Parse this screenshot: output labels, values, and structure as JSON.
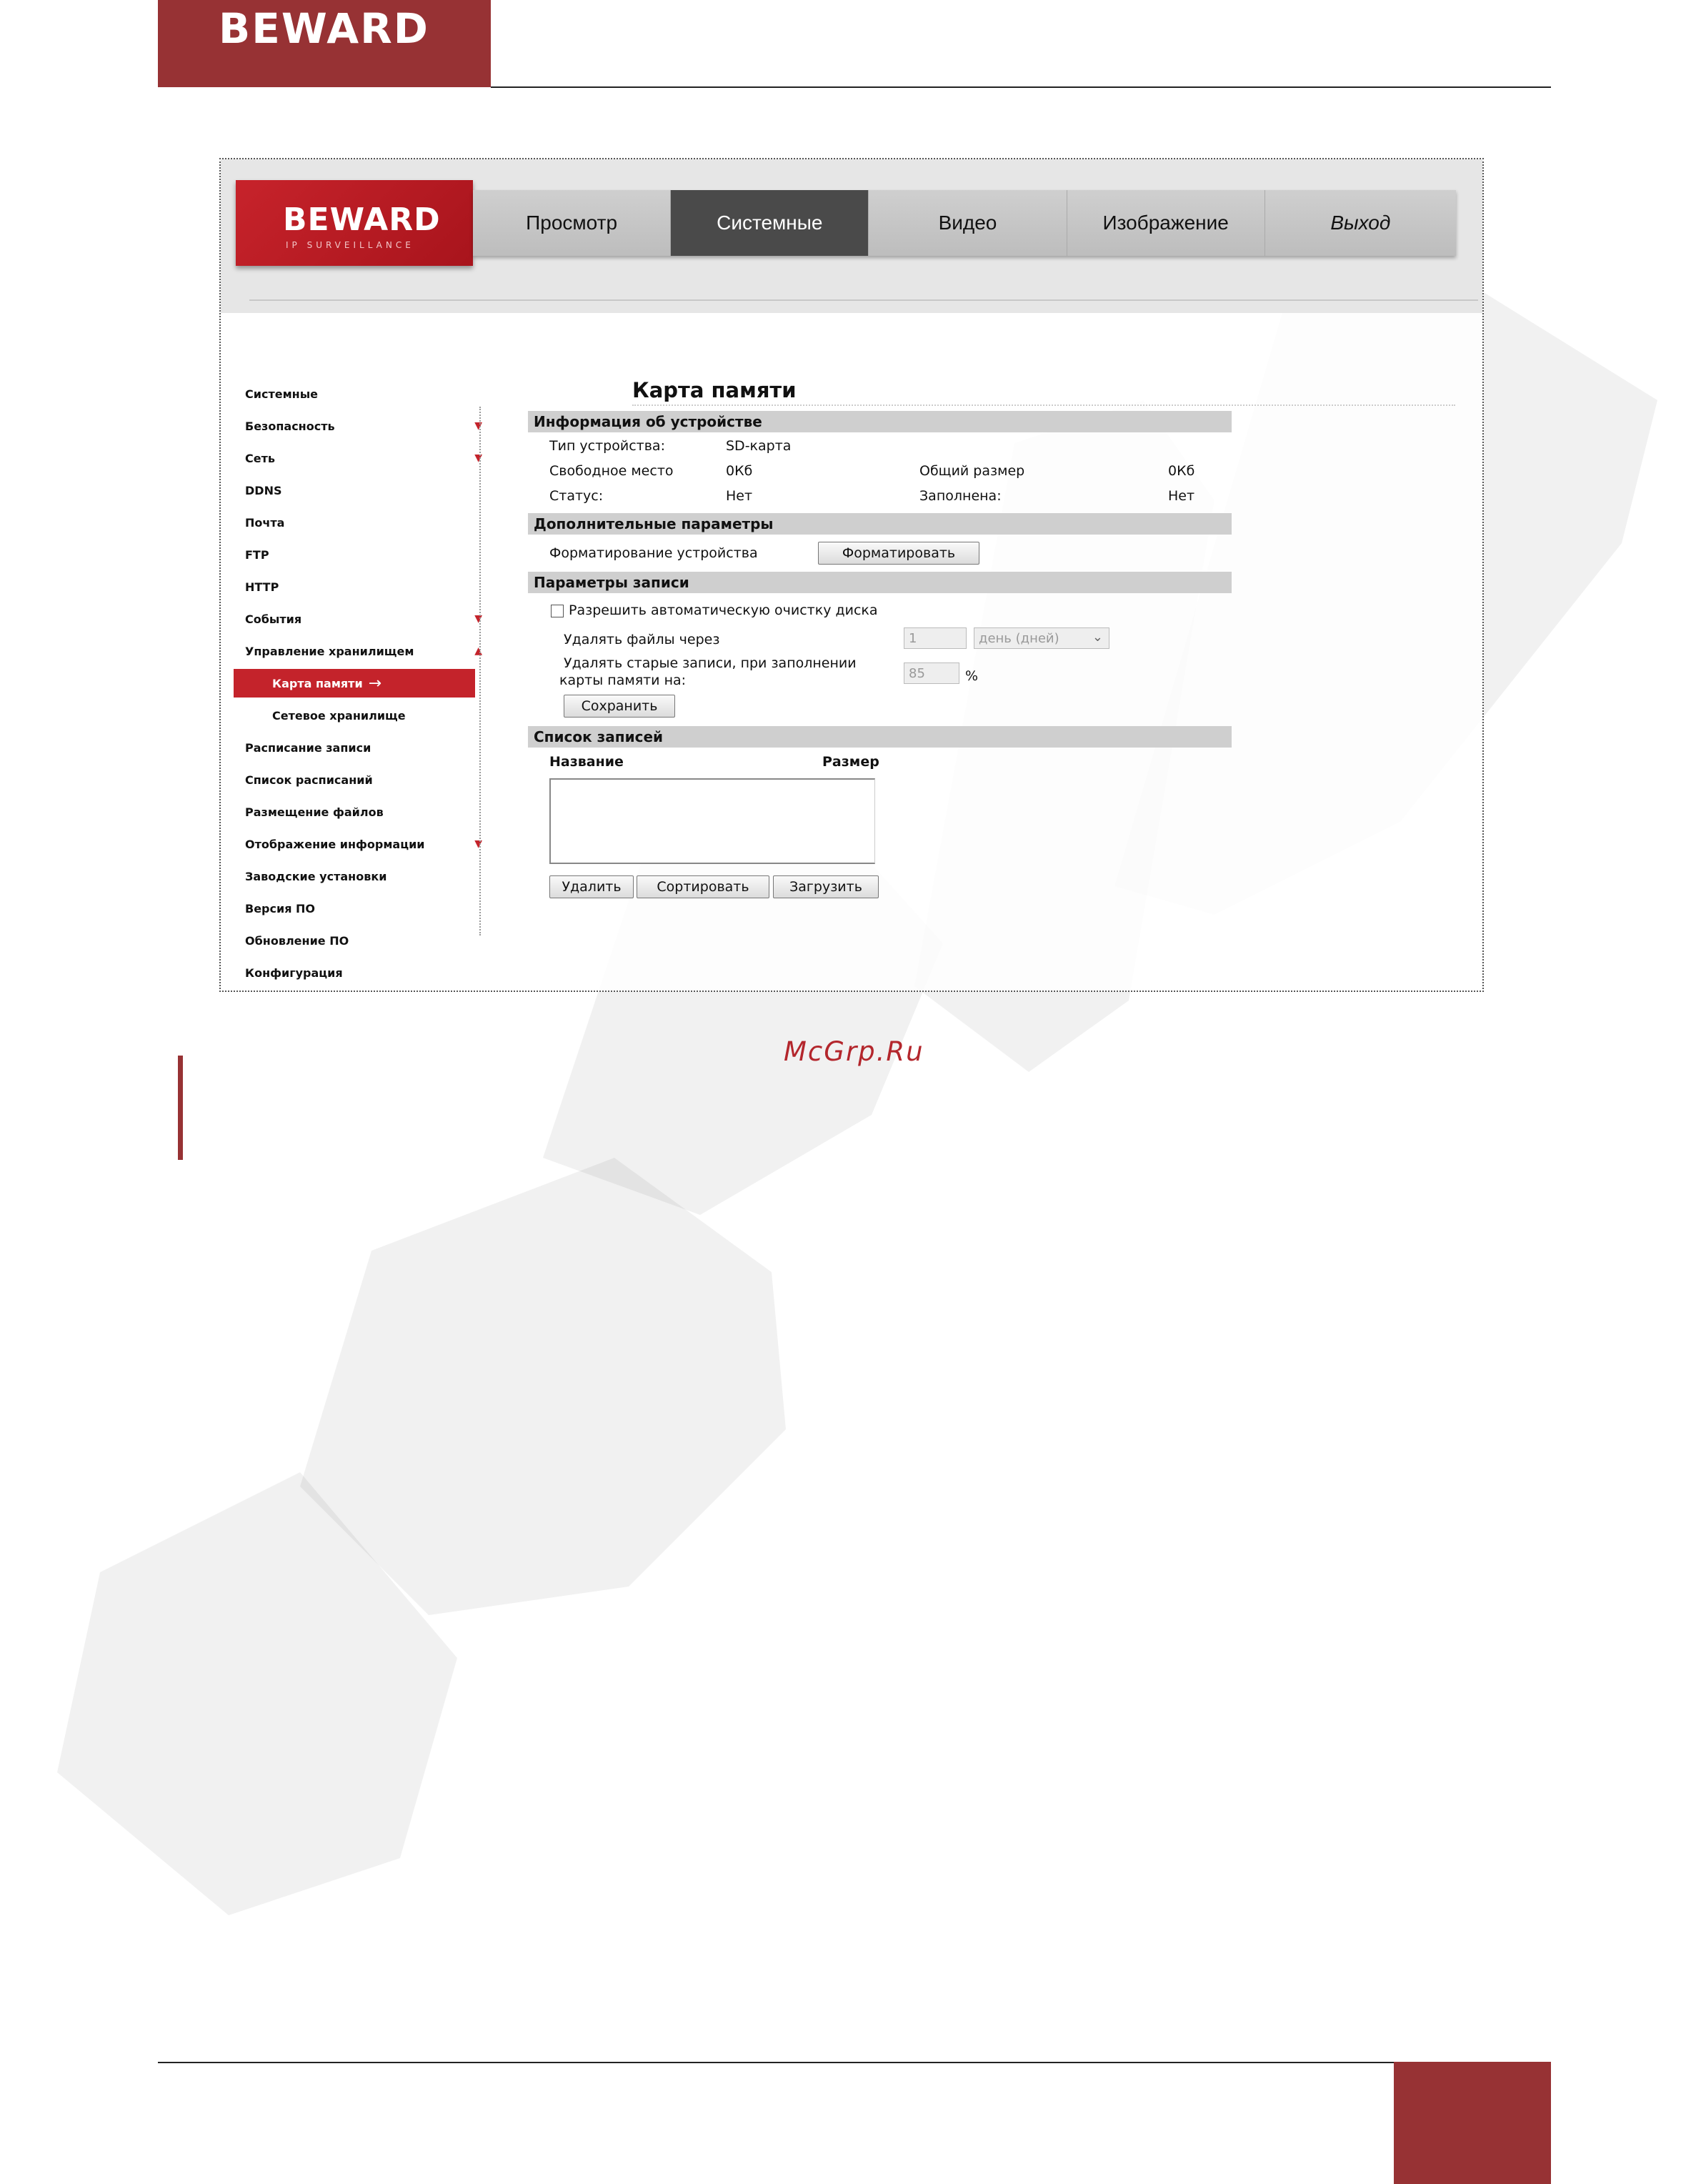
{
  "document": {
    "logo_text": "BEWARD",
    "watermark_link": "McGrp.Ru",
    "colors": {
      "brand": "#973234",
      "accent_red": "#c4232b",
      "section_gray": "#cfcfcf",
      "nav_active": "#4a4a4a"
    }
  },
  "camera_ui": {
    "logo": {
      "text": "BEWARD",
      "subtitle": "IP SURVEILLANCE"
    },
    "nav_tabs": [
      {
        "label": "Просмотр",
        "active": false
      },
      {
        "label": "Системные",
        "active": true
      },
      {
        "label": "Видео",
        "active": false
      },
      {
        "label": "Изображение",
        "active": false
      },
      {
        "label": "Выход",
        "active": false
      }
    ],
    "sidebar": {
      "items": [
        {
          "label": "Системные"
        },
        {
          "label": "Безопасность",
          "expand_icon": "arrow-down"
        },
        {
          "label": "Сеть",
          "expand_icon": "arrow-down"
        },
        {
          "label": "DDNS"
        },
        {
          "label": "Почта"
        },
        {
          "label": "FTP"
        },
        {
          "label": "HTTP"
        },
        {
          "label": "События",
          "expand_icon": "arrow-down"
        },
        {
          "label": "Управление хранилищем",
          "expand_icon": "arrow-up"
        },
        {
          "label": "Карта памяти",
          "sub": true,
          "active": true
        },
        {
          "label": "Сетевое хранилище",
          "sub": true
        },
        {
          "label": "Расписание записи"
        },
        {
          "label": "Список расписаний"
        },
        {
          "label": "Размещение файлов"
        },
        {
          "label": "Отображение информации",
          "expand_icon": "arrow-down"
        },
        {
          "label": "Заводские установки"
        },
        {
          "label": "Версия ПО"
        },
        {
          "label": "Обновление ПО"
        },
        {
          "label": "Конфигурация"
        }
      ],
      "arrow_down_glyph": "▼",
      "arrow_up_glyph": "▲",
      "active_arrow_glyph": "→"
    },
    "page_title": "Карта памяти",
    "device_info": {
      "section_label": "Информация об устройстве",
      "type_label": "Тип устройства:",
      "type_value": "SD-карта",
      "free_label": "Свободное место",
      "free_value": "0Кб",
      "total_label": "Общий размер",
      "total_value": "0Кб",
      "status_label": "Статус:",
      "status_value": "Нет",
      "full_label": "Заполнена:",
      "full_value": "Нет"
    },
    "extra_params": {
      "section_label": "Дополнительные параметры",
      "format_label": "Форматирование устройства",
      "format_button": "Форматировать"
    },
    "record_params": {
      "section_label": "Параметры записи",
      "auto_clean_label": "Разрешить автоматическую очистку диска",
      "auto_clean_checked": false,
      "delete_after_label": "Удалять файлы через",
      "delete_after_value": "1",
      "delete_after_unit": "день (дней)",
      "delete_old_label_line1": "Удалять старые записи, при заполнении",
      "delete_old_label_line2": "карты памяти на:",
      "delete_old_value": "85",
      "percent_sign": "%",
      "save_button": "Сохранить"
    },
    "records_list": {
      "section_label": "Список записей",
      "col_name": "Название",
      "col_size": "Размер",
      "rows": [],
      "delete_button": "Удалить",
      "sort_button": "Сортировать",
      "download_button": "Загрузить"
    }
  }
}
